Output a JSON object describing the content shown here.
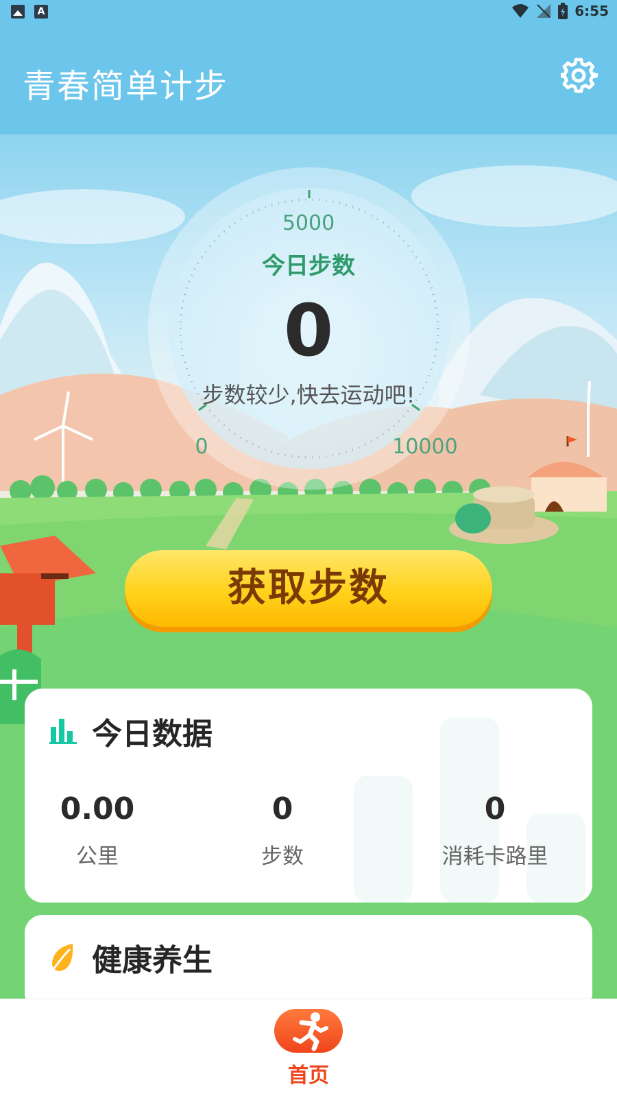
{
  "status_bar": {
    "time": "6:55"
  },
  "header": {
    "title": "青春简单计步",
    "settings_icon": "gear-icon"
  },
  "dial": {
    "goal_label": "5000",
    "title": "今日步数",
    "steps": "0",
    "tip": "步数较少,快去运动吧!",
    "min_label": "0",
    "max_label": "10000",
    "progress_fraction": 0
  },
  "get_steps_button": {
    "label": "获取步数"
  },
  "today_card": {
    "title": "今日数据",
    "icon": "bar-chart-icon",
    "stats": [
      {
        "value": "0.00",
        "label": "公里"
      },
      {
        "value": "0",
        "label": "步数"
      },
      {
        "value": "0",
        "label": "消耗卡路里"
      }
    ]
  },
  "health_card": {
    "title": "健康养生",
    "icon": "leaf-icon"
  },
  "bottom_nav": {
    "home_label": "首页",
    "home_icon": "running-man-icon"
  },
  "colors": {
    "accent_sky": "#6cc5ea",
    "button_yellow": "#ffd21c",
    "nav_orange": "#f0451c",
    "stat_green": "#2e9a6a"
  }
}
